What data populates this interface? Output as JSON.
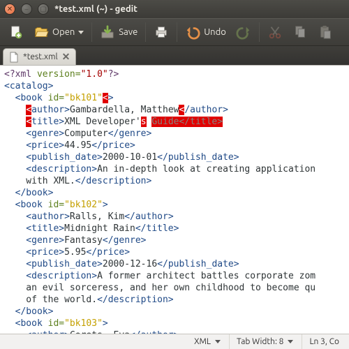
{
  "window": {
    "title": "*test.xml (~) - gedit"
  },
  "toolbar": {
    "open_label": "Open",
    "save_label": "Save",
    "undo_label": "Undo"
  },
  "tab": {
    "label": "*test.xml"
  },
  "code": {
    "l1_pi_open": "<?xml ",
    "l1_attr": "version=",
    "l1_val": "\"1.0\"",
    "l1_pi_close": "?>",
    "l2": "<catalog>",
    "l3_a": "  <book ",
    "l3_attr": "id=",
    "l3_val": "\"bk101\"",
    "l3_c1": "<",
    "l3_c2": ">",
    "l4_a": "    ",
    "l4_h1": "<",
    "l4_t1": "author>",
    "l4_txt": "Gambardella, Matthew",
    "l4_t2": "<",
    "l4_h2": "/author>",
    "l5_a": "    ",
    "l5_h1": "<",
    "l5_t1": "title>",
    "l5_txt": "XML Developer'",
    "l5_h2": "s",
    "l5_sp": " ",
    "l5_h3": "Guide</title>",
    "l6_t1": "    <genre>",
    "l6_txt": "Computer",
    "l6_t2": "</genre>",
    "l7_t1": "    <price>",
    "l7_txt": "44.95",
    "l7_t2": "</price>",
    "l8_t1": "    <publish_date>",
    "l8_txt": "2000-10-01",
    "l8_t2": "</publish_date>",
    "l9_t1": "    <description>",
    "l9_txt": "An in-depth look at creating application",
    "l10_txt": "    with XML.",
    "l10_t2": "</description>",
    "l11": "  </book>",
    "l12_a": "  <book ",
    "l12_attr": "id=",
    "l12_val": "\"bk102\"",
    "l12_b": ">",
    "l13_t1": "    <author>",
    "l13_txt": "Ralls, Kim",
    "l13_t2": "</author>",
    "l14_t1": "    <title>",
    "l14_txt": "Midnight Rain",
    "l14_t2": "</title>",
    "l15_t1": "    <genre>",
    "l15_txt": "Fantasy",
    "l15_t2": "</genre>",
    "l16_t1": "    <price>",
    "l16_txt": "5.95",
    "l16_t2": "</price>",
    "l17_t1": "    <publish_date>",
    "l17_txt": "2000-12-16",
    "l17_t2": "</publish_date>",
    "l18_t1": "    <description>",
    "l18_txt": "A former architect battles corporate zom",
    "l19_txt": "    an evil sorceress, and her own childhood to become qu",
    "l20_txt": "    of the world.",
    "l20_t2": "</description>",
    "l21": "  </book>",
    "l22_a": "  <book ",
    "l22_attr": "id=",
    "l22_val": "\"bk103\"",
    "l22_b": ">",
    "l23_t1": "    <author>",
    "l23_txt": "Corets, Eva",
    "l23_t2": "</author>"
  },
  "status": {
    "lang": "XML",
    "tabwidth": "Tab Width: 8",
    "pos": "Ln 3, Co"
  }
}
